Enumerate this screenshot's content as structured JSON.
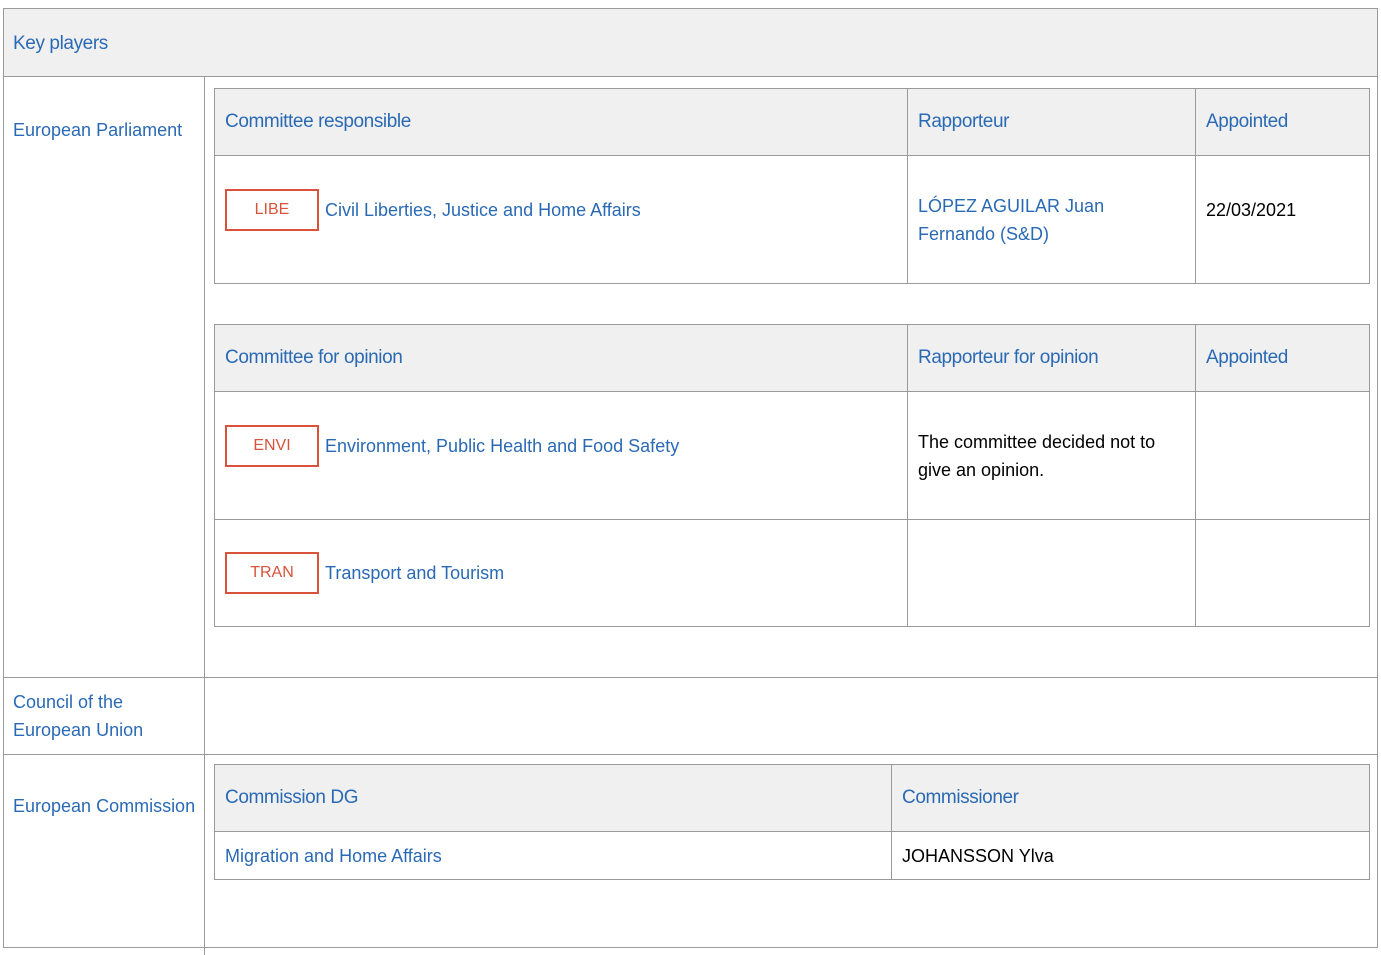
{
  "title": "Key players",
  "sections": {
    "parliament": {
      "label": "European Parliament"
    },
    "council": {
      "label": "Council of the European Union"
    },
    "commission": {
      "label": "European Commission"
    }
  },
  "responsible_table": {
    "headers": [
      "Committee responsible",
      "Rapporteur",
      "Appointed"
    ],
    "rows": [
      {
        "code": "LIBE",
        "committee": "Civil Liberties, Justice and Home Affairs",
        "rapporteur": "LÓPEZ AGUILAR Juan Fernando (S&D)",
        "appointed": "22/03/2021"
      }
    ]
  },
  "opinion_table": {
    "headers": [
      "Committee for opinion",
      "Rapporteur for opinion",
      "Appointed"
    ],
    "rows": [
      {
        "code": "ENVI",
        "committee": "Environment, Public Health and Food Safety",
        "rapporteur": "The committee decided not to give an opinion.",
        "appointed": ""
      },
      {
        "code": "TRAN",
        "committee": "Transport and Tourism",
        "rapporteur": "",
        "appointed": ""
      }
    ]
  },
  "commission_table": {
    "headers": [
      "Commission DG",
      "Commissioner"
    ],
    "rows": [
      {
        "dg": "Migration and Home Affairs",
        "commissioner": "JOHANSSON Ylva"
      }
    ]
  },
  "colors": {
    "link": "#2a6ab5",
    "badge": "#d9523a",
    "header_bg": "#f0f0f0",
    "border": "#9a9a9a"
  }
}
